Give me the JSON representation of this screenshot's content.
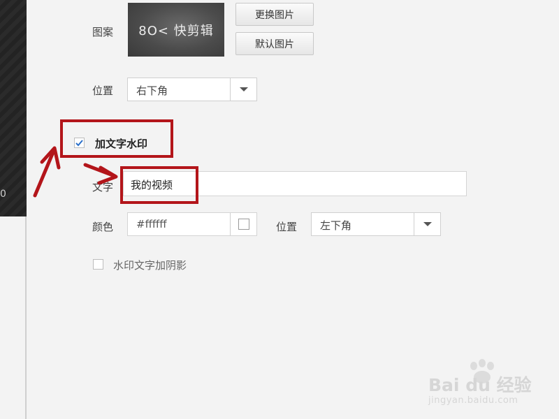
{
  "sidebar": {
    "partial_number": "0"
  },
  "watermark_image": {
    "pattern_label": "图案",
    "logo_text": "8O< 快剪辑",
    "replace_button": "更换图片",
    "default_button": "默认图片",
    "position_label": "位置",
    "position_value": "右下角"
  },
  "text_watermark": {
    "checkbox_label": "加文字水印",
    "checked": true,
    "text_label": "文字",
    "text_value": "我的视频",
    "color_label": "颜色",
    "color_value": "#ffffff",
    "position_label": "位置",
    "position_value": "左下角",
    "shadow_label": "水印文字加阴影",
    "shadow_checked": false
  },
  "colors": {
    "annotation_red": "#b3151a",
    "check_blue": "#2a6fc9"
  },
  "site_watermark": {
    "brand": "Bai du 经验",
    "url": "jingyan.baidu.com"
  }
}
